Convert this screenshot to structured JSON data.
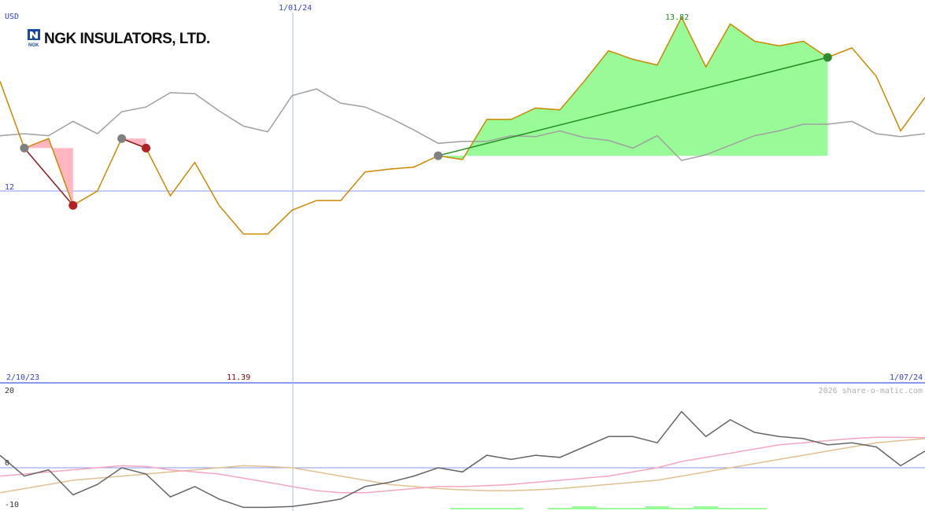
{
  "header": {
    "currency": "USD",
    "company": "NGK INSULATORS, LTD.",
    "logo_mark": "NGK",
    "watermark": "2026 share-o-matic.com"
  },
  "colors": {
    "price": "#cc8800",
    "benchmark": "#a0a0a0",
    "grid": "#8899ee",
    "gain_fill": "#98fb98",
    "loss_fill": "#ffb6c1",
    "buy_marker": "#808080",
    "sell_marker": "#b22222",
    "high_label": "#228b22",
    "low_label": "#8b0000",
    "osc_black": "#666666",
    "osc_pink": "#f4a6c0",
    "osc_tan": "#e0c090"
  },
  "chart_data": [
    {
      "type": "line",
      "panel": "price",
      "ylabel": "USD",
      "y_reference": 12,
      "y_reference_label": "12",
      "x_start_label": "2/10/23",
      "x_end_label": "1/07/24",
      "x_mid_label": "1/01/24",
      "high": {
        "label": "13.82",
        "value": 13.82
      },
      "low": {
        "label": "11.39",
        "value": 11.39
      },
      "series": [
        {
          "name": "",
          "role": "price",
          "values": [
            13.15,
            12.45,
            12.55,
            11.85,
            12.0,
            12.55,
            12.45,
            11.95,
            12.3,
            11.85,
            11.55,
            11.55,
            11.8,
            11.9,
            11.9,
            12.2,
            12.23,
            12.25,
            12.37,
            12.33,
            12.75,
            12.75,
            12.87,
            12.85,
            13.15,
            13.47,
            13.38,
            13.32,
            13.82,
            13.3,
            13.75,
            13.57,
            13.52,
            13.57,
            13.4,
            13.5,
            13.2,
            12.63,
            12.98
          ]
        },
        {
          "name": "",
          "role": "benchmark",
          "values": [
            12.58,
            12.6,
            12.58,
            12.73,
            12.6,
            12.83,
            12.88,
            13.03,
            13.02,
            12.84,
            12.68,
            12.62,
            13.0,
            13.07,
            12.92,
            12.88,
            12.77,
            12.64,
            12.5,
            12.52,
            12.52,
            12.58,
            12.57,
            12.63,
            12.56,
            12.53,
            12.45,
            12.58,
            12.32,
            12.38,
            12.48,
            12.58,
            12.63,
            12.7,
            12.7,
            12.73,
            12.6,
            12.57,
            12.6
          ]
        }
      ],
      "trades": [
        {
          "entry_index": 1,
          "exit_index": 3,
          "entry_value": 12.45,
          "exit_value": 11.85,
          "result": "loss"
        },
        {
          "entry_index": 5,
          "exit_index": 6,
          "entry_value": 12.55,
          "exit_value": 12.45,
          "result": "loss"
        },
        {
          "entry_index": 18,
          "exit_index": 34,
          "entry_value": 12.37,
          "exit_value": 13.4,
          "result": "gain"
        }
      ]
    },
    {
      "type": "line",
      "panel": "oscillator",
      "yticks": [
        "20",
        "0",
        "-10"
      ],
      "ylim": [
        -10,
        20
      ],
      "series": [
        {
          "name": "",
          "role": "osc_main",
          "values": [
            3,
            -2,
            -0.5,
            -6.5,
            -4,
            0,
            -1.5,
            -7,
            -4.5,
            -7.5,
            -9.5,
            -9.5,
            -9.3,
            -8.5,
            -7.5,
            -4.5,
            -3.5,
            -2,
            0,
            -1,
            3,
            2,
            3,
            2.5,
            5,
            7.5,
            7.5,
            6,
            13.5,
            7.5,
            11.5,
            8.5,
            7.5,
            7,
            5.5,
            6,
            5,
            0.5,
            4
          ]
        },
        {
          "name": "",
          "role": "osc_signal",
          "values": [
            -2,
            -1.5,
            -1,
            -0.5,
            0,
            0.5,
            0.3,
            -0.5,
            -1,
            -1.5,
            -2.5,
            -3.5,
            -4.5,
            -5.5,
            -6,
            -6,
            -5.5,
            -5,
            -4.5,
            -4.5,
            -4.3,
            -4,
            -3.5,
            -3,
            -2.5,
            -2,
            -1,
            0,
            1.5,
            2.5,
            3.5,
            4.5,
            5.5,
            6,
            6.5,
            7,
            7.3,
            7.3,
            7.2
          ]
        },
        {
          "name": "",
          "role": "osc_slow",
          "values": [
            -6,
            -5,
            -4,
            -3,
            -2.5,
            -2,
            -1.5,
            -1,
            -0.5,
            0,
            0.5,
            0.3,
            0,
            -1,
            -2,
            -3,
            -4,
            -4.5,
            -5,
            -5.3,
            -5.5,
            -5.5,
            -5.3,
            -5,
            -4.5,
            -4,
            -3.5,
            -3,
            -2,
            -1,
            0,
            1,
            2,
            3,
            4,
            5,
            6,
            6.5,
            7
          ]
        }
      ],
      "histogram": [
        0,
        0,
        0,
        0,
        0,
        0,
        0,
        0,
        0,
        0,
        0,
        0,
        0,
        0,
        0,
        0,
        0,
        0,
        0,
        1,
        1,
        1,
        0,
        1,
        2,
        1,
        1,
        2,
        1,
        2,
        1,
        1,
        0,
        0,
        0,
        0,
        0,
        0,
        0
      ]
    }
  ]
}
